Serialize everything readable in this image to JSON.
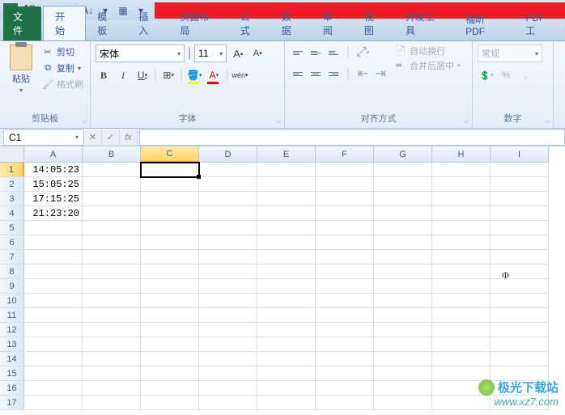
{
  "tabs": {
    "file": "文件",
    "home": "开始",
    "template": "模板",
    "insert": "插入",
    "pagelayout": "页面布局",
    "formula": "公式",
    "data": "数据",
    "review": "审阅",
    "view": "视图",
    "dev": "开发工具",
    "foxit": "福昕PDF",
    "pdftool": "PDF工"
  },
  "ribbon": {
    "clipboard": {
      "paste": "粘贴",
      "cut": "剪切",
      "copy": "复制",
      "format_painter": "格式刷",
      "label": "剪贴板"
    },
    "font": {
      "name": "宋体",
      "size": "11",
      "label": "字体",
      "bold_char": "B",
      "italic_char": "I",
      "underline_char": "U",
      "a_large": "A",
      "a_small": "A",
      "a_accent": "A",
      "wen": "wén"
    },
    "align": {
      "wrap": "自动换行",
      "merge": "合并后居中",
      "label": "对齐方式"
    },
    "number": {
      "format": "常规",
      "label": "数字",
      "percent": "%",
      "comma": ","
    }
  },
  "formula_bar": {
    "name_box": "C1",
    "fx": "fx",
    "cancel": "✕",
    "confirm": "✓"
  },
  "grid": {
    "cols": [
      "A",
      "B",
      "C",
      "D",
      "E",
      "F",
      "G",
      "H",
      "I"
    ],
    "rows": [
      1,
      2,
      3,
      4,
      5,
      6,
      7,
      8,
      9,
      10,
      11,
      12,
      13,
      14,
      15,
      16,
      17
    ],
    "data": {
      "A1": "14:05:23",
      "A2": "15:05:25",
      "A3": "17:15:25",
      "A4": "21:23:20"
    },
    "active_cell": "C1",
    "active_col": "C",
    "active_row": 1
  },
  "watermark": {
    "title": "极光下载站",
    "url": "www.xz7.com"
  },
  "cursor_glyph": "Φ"
}
